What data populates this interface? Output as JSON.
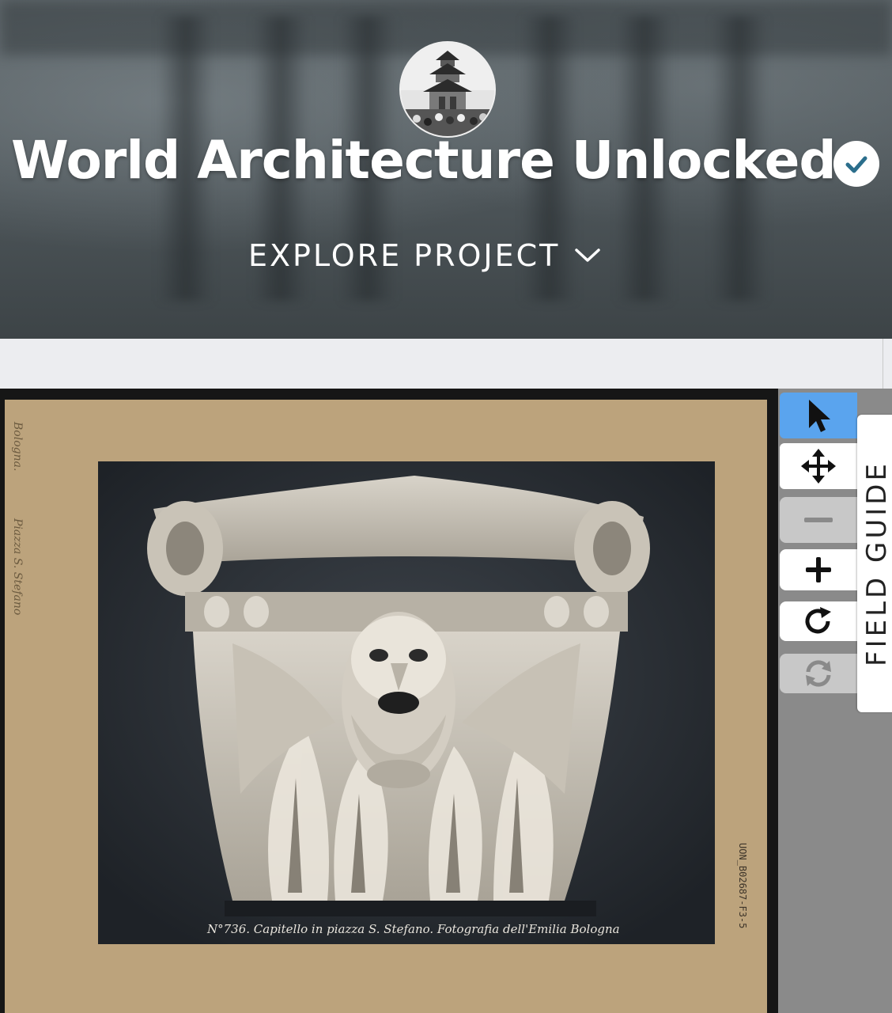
{
  "header": {
    "project_title": "World Architecture Unlocked",
    "explore_label": "EXPLORE PROJECT",
    "verified_icon": "verified-check-icon"
  },
  "subject": {
    "margin_notes": [
      "Bologna.",
      "Piazza S. Stefano"
    ],
    "caption": "N°736. Capitello in piazza S. Stefano. Fotografia dell'Emilia Bologna",
    "catalog_number": "UON_B02687-F3-5"
  },
  "toolbar": {
    "tools": [
      {
        "name": "annotate",
        "icon": "pointer-icon",
        "state": "active"
      },
      {
        "name": "move",
        "icon": "move-icon",
        "state": "enabled"
      },
      {
        "name": "zoom-out",
        "icon": "minus-icon",
        "state": "disabled"
      },
      {
        "name": "zoom-in",
        "icon": "plus-icon",
        "state": "enabled"
      },
      {
        "name": "rotate",
        "icon": "rotate-icon",
        "state": "enabled"
      },
      {
        "name": "reset",
        "icon": "reset-icon",
        "state": "disabled"
      }
    ],
    "field_guide_label": "FIELD GUIDE"
  },
  "colors": {
    "accent": "#5aa4ee",
    "verified_check": "#2b6e8c",
    "card": "#bca37c"
  }
}
